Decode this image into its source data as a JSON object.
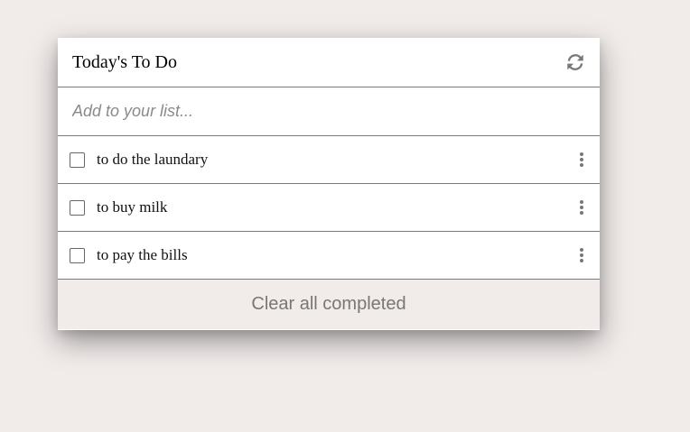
{
  "app": {
    "title": "Today's To Do",
    "refresh_icon": "refresh-icon"
  },
  "add_field": {
    "placeholder": "Add to your list...",
    "value": ""
  },
  "items": [
    {
      "label": "to do the laundary",
      "checked": false,
      "menu_icon": "more-vertical-icon"
    },
    {
      "label": "to buy milk",
      "checked": false,
      "menu_icon": "more-vertical-icon"
    },
    {
      "label": "to pay the bills",
      "checked": false,
      "menu_icon": "more-vertical-icon"
    }
  ],
  "footer": {
    "clear_label": "Clear all completed"
  },
  "colors": {
    "page_background": "#f1ebea",
    "card_background": "#ffffff",
    "divider": "#7a7a7a",
    "icon_gray": "#777777"
  }
}
